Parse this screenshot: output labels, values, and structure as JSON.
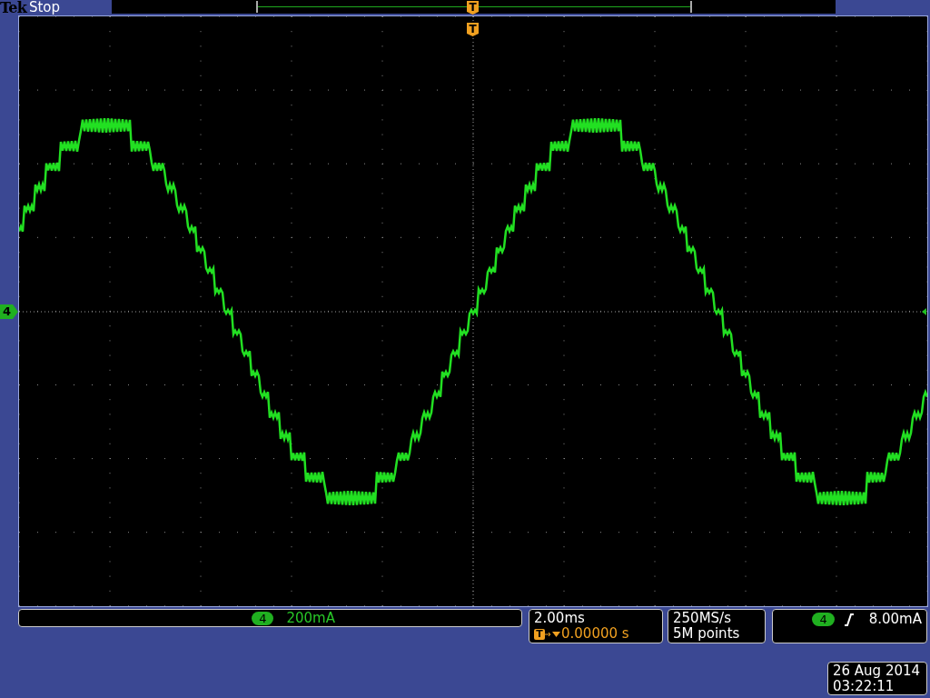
{
  "header": {
    "brand": "Tek",
    "status": "Stop"
  },
  "record_view": {
    "trigger_marker": "T"
  },
  "graticule": {
    "trigger_marker": "T",
    "channel_marker": "4"
  },
  "channel_readout": {
    "channel": "4",
    "scale": "200mA"
  },
  "timebase": {
    "scale": "2.00ms",
    "trigger_marker": "T",
    "position": "0.00000 s"
  },
  "acquisition": {
    "sample_rate": "250MS/s",
    "record_length": "5M points"
  },
  "trigger": {
    "channel": "4",
    "level": "8.00mA"
  },
  "clock": {
    "date": "26 Aug 2014",
    "time": "03:22:11"
  }
}
